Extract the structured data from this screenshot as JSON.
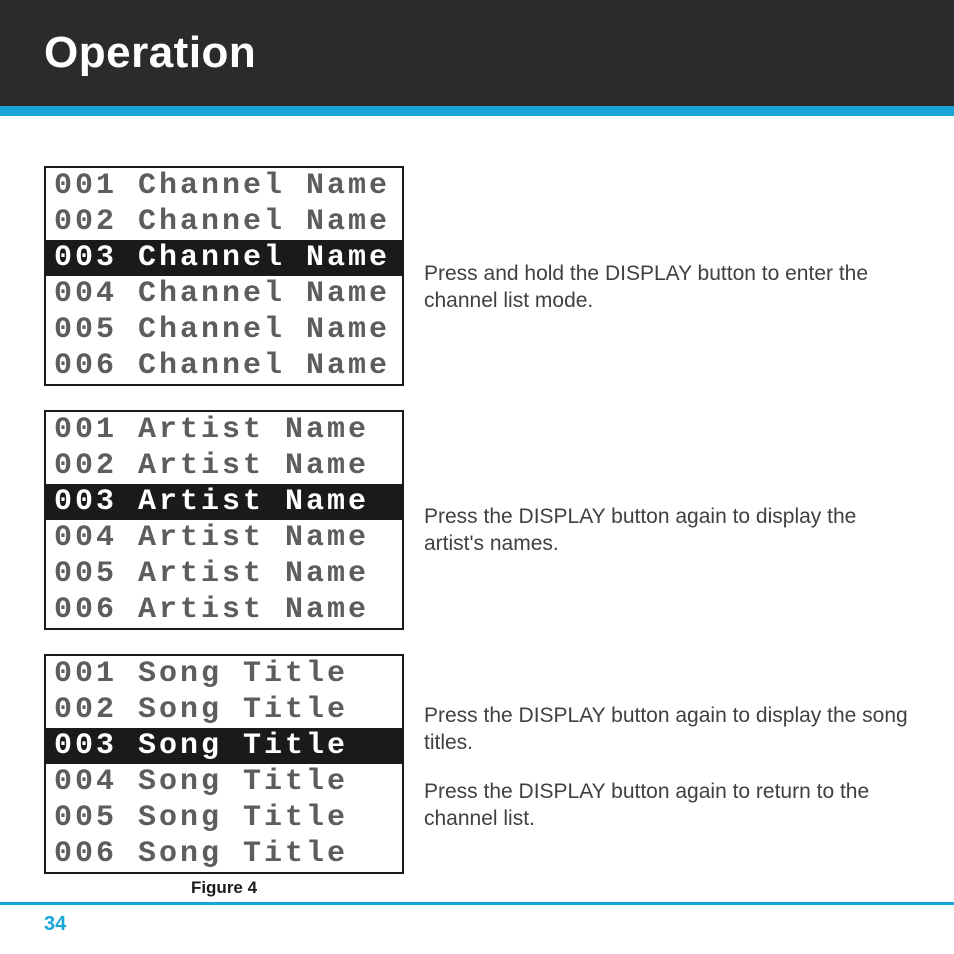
{
  "header": {
    "title": "Operation"
  },
  "screens": [
    {
      "rows": [
        {
          "text": "001 Channel Name",
          "selected": false
        },
        {
          "text": "002 Channel Name",
          "selected": false
        },
        {
          "text": "003 Channel Name",
          "selected": true
        },
        {
          "text": "004 Channel Name",
          "selected": false
        },
        {
          "text": "005 Channel Name",
          "selected": false
        },
        {
          "text": "006 Channel Name",
          "selected": false
        }
      ]
    },
    {
      "rows": [
        {
          "text": "001 Artist Name",
          "selected": false
        },
        {
          "text": "002 Artist Name",
          "selected": false
        },
        {
          "text": "003 Artist Name",
          "selected": true
        },
        {
          "text": "004 Artist Name",
          "selected": false
        },
        {
          "text": "005 Artist Name",
          "selected": false
        },
        {
          "text": "006 Artist Name",
          "selected": false
        }
      ]
    },
    {
      "rows": [
        {
          "text": "001 Song Title",
          "selected": false
        },
        {
          "text": "002 Song Title",
          "selected": false
        },
        {
          "text": "003 Song Title",
          "selected": true
        },
        {
          "text": "004 Song Title",
          "selected": false
        },
        {
          "text": "005 Song Title",
          "selected": false
        },
        {
          "text": "006 Song Title",
          "selected": false
        }
      ]
    }
  ],
  "caption": "Figure 4",
  "instructions": {
    "i1": "Press and hold the DISPLAY button to enter the channel list mode.",
    "i2": "Press the DISPLAY button again to display the artist's names.",
    "i3a": "Press the DISPLAY button again to display the song titles.",
    "i3b": "Press the DISPLAY button again to return to the channel list."
  },
  "page_number": "34"
}
